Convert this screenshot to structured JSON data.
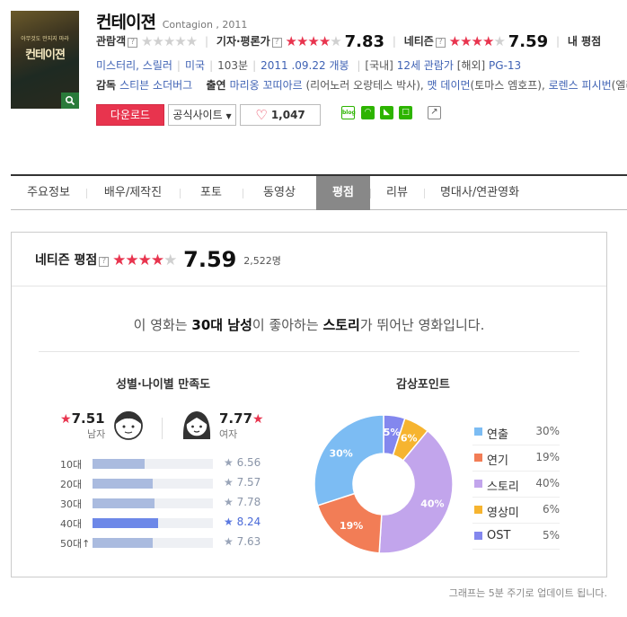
{
  "poster": {
    "tagline": "아무것도 만지지 마라",
    "title": "컨테이젼",
    "zoom_icon": "search-icon"
  },
  "movie": {
    "title_ko": "컨테이젼",
    "title_en": "Contagion , 2011"
  },
  "scores": {
    "audience_label": "관람객",
    "critic_label": "기자·평론가",
    "critic_score": "7.83",
    "critic_stars": 4,
    "netizen_label": "네티즌",
    "netizen_score": "7.59",
    "netizen_stars": 4,
    "my_label": "내 평점"
  },
  "info": {
    "genre": "미스터리, 스릴러",
    "country": "미국",
    "runtime": "103분",
    "release": "2011 .09.22 개봉",
    "rating_kr_prefix": "[국내]",
    "rating_kr": "12세 관람가",
    "rating_ov_prefix": "[해외]",
    "rating_ov": "PG-13"
  },
  "cast": {
    "director_label": "감독",
    "director": "스티븐 소더버그",
    "cast_label": "출연",
    "actor1": "마리옹 꼬띠아르",
    "role1": "(리어노러 오랑테스 박사),",
    "actor2": "맷 데이먼",
    "role2": "(토마스 엠호프),",
    "actor3": "로렌스 피시번",
    "role3": "(엘리"
  },
  "buttons": {
    "download": "다운로드",
    "official_site": "공식사이트",
    "like_count": "1,047"
  },
  "share": {
    "blog": "blog"
  },
  "tabs": [
    "주요정보",
    "배우/제작진",
    "포토",
    "동영상",
    "평점",
    "리뷰",
    "명대사/연관영화"
  ],
  "active_tab": "평점",
  "rating": {
    "label": "네티즌 평점",
    "score": "7.59",
    "stars": 4,
    "count": "2,522명",
    "summary_pre": "이 영화는 ",
    "summary_b1": "30대 남성",
    "summary_mid": "이 좋아하는 ",
    "summary_b2": "스토리",
    "summary_post": "가 뛰어난 영화입니다."
  },
  "demographics": {
    "title": "성별·나이별 만족도",
    "male_score": "7.51",
    "male_label": "남자",
    "female_score": "7.77",
    "female_label": "여자",
    "ages": [
      {
        "label": "10대",
        "score": 6.56,
        "highlight": false
      },
      {
        "label": "20대",
        "score": 7.57,
        "highlight": false
      },
      {
        "label": "30대",
        "score": 7.78,
        "highlight": false
      },
      {
        "label": "40대",
        "score": 8.24,
        "highlight": true
      },
      {
        "label": "50대↑",
        "score": 7.63,
        "highlight": false
      }
    ]
  },
  "chart_data": {
    "type": "pie",
    "title": "감상포인트",
    "categories": [
      "연출",
      "연기",
      "스토리",
      "영상미",
      "OST"
    ],
    "values": [
      30,
      19,
      40,
      6,
      5
    ],
    "labels": [
      "30%",
      "19%",
      "40%",
      "6%",
      "5%"
    ],
    "colors": [
      "#7cbcf3",
      "#f27d56",
      "#c2a5ec",
      "#f6b430",
      "#8387ee"
    ],
    "donut": true
  },
  "footer": "그래프는 5분 주기로 업데이트 됩니다.",
  "colors": {
    "accent": "#e8344e",
    "link": "#3f62b4",
    "tab_active": "#888888"
  }
}
